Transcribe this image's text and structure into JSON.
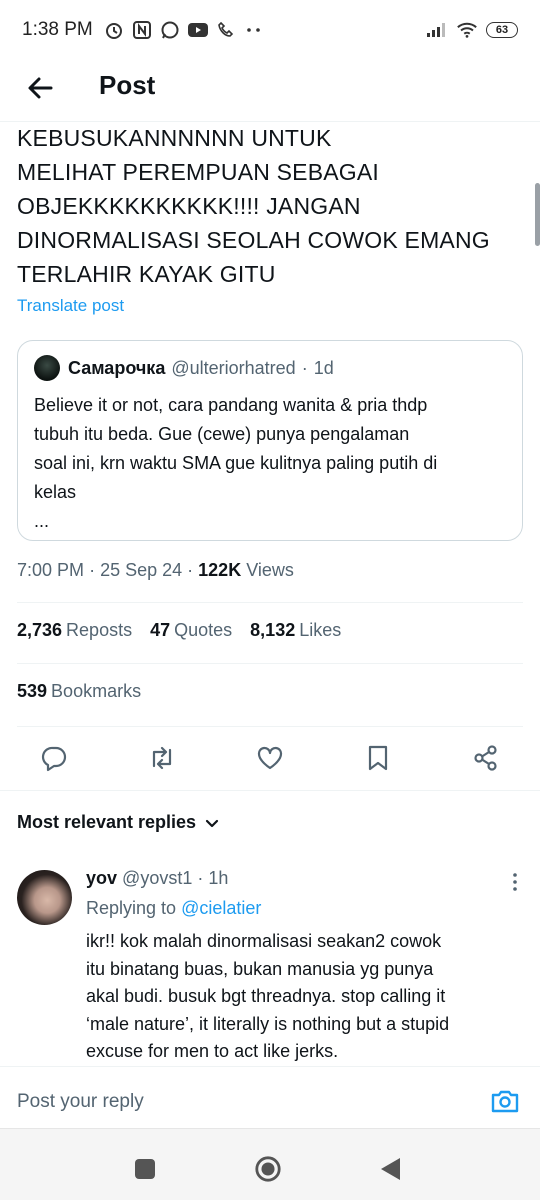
{
  "status_bar": {
    "time": "1:38 PM",
    "battery": "63",
    "icons": [
      "alarm-icon",
      "nfc-icon",
      "whatsapp-icon",
      "youtube-icon",
      "phone-icon",
      "more-dots-icon",
      "signal-icon",
      "wifi-icon",
      "battery-icon"
    ]
  },
  "header": {
    "title": "Post"
  },
  "tweet": {
    "lines": [
      "KEBUSUKANNNNNN UNTUK",
      "MELIHAT PEREMPUAN SEBAGAI",
      "OBJEKKKKKKKKKK!!!! JANGAN",
      "DINORMALISASI SEOLAH COWOK EMANG",
      "TERLAHIR KAYAK GITU"
    ],
    "translate_label": "Translate post",
    "time": "7:00 PM",
    "date": "25 Sep 24",
    "views": "122K",
    "views_label": "Views"
  },
  "quote": {
    "name": "Самарочка",
    "handle": "@ulteriorhatred",
    "age": "1d",
    "lines": [
      "Believe it or not, cara pandang wanita & pria thdp",
      "tubuh itu beda. Gue (cewe) punya pengalaman",
      "soal ini, krn waktu SMA gue kulitnya paling putih di",
      "kelas",
      "..."
    ]
  },
  "stats": {
    "reposts_count": "2,736",
    "reposts_label": "Reposts",
    "quotes_count": "47",
    "quotes_label": "Quotes",
    "likes_count": "8,132",
    "likes_label": "Likes",
    "bookmarks_count": "539",
    "bookmarks_label": "Bookmarks"
  },
  "replies": {
    "filter_label": "Most relevant replies",
    "items": [
      {
        "name": "yov",
        "handle": "@yovst1",
        "age": "1h",
        "replying_label": "Replying to",
        "replying_to": "@cielatier",
        "lines": [
          "ikr!! kok malah dinormalisasi seakan2 cowok",
          "itu binatang buas, bukan manusia yg punya",
          "akal budi. busuk bgt threadnya. stop calling it",
          "‘male nature’, it literally is nothing but a stupid",
          "excuse for men to act like jerks."
        ]
      }
    ]
  },
  "compose": {
    "placeholder": "Post your reply"
  }
}
